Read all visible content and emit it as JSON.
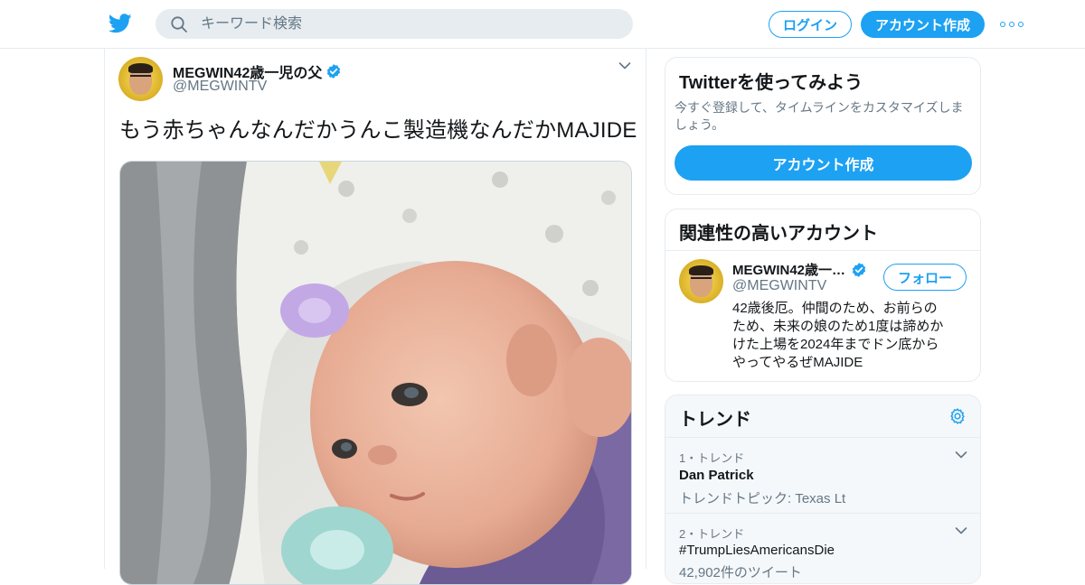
{
  "header": {
    "search_placeholder": "キーワード検索",
    "login_label": "ログイン",
    "signup_label": "アカウント作成"
  },
  "tweet": {
    "author_name": "MEGWIN42歳一児の父",
    "author_handle": "@MEGWINTV",
    "text": "もう赤ちゃんなんだかうんこ製造機なんだかMAJIDE"
  },
  "sidebar": {
    "try_twitter": {
      "title": "Twitterを使ってみよう",
      "description": "今すぐ登録して、タイムラインをカスタマイズしましょう。",
      "cta_label": "アカウント作成"
    },
    "related": {
      "title": "関連性の高いアカウント",
      "account": {
        "name": "MEGWIN42歳一…",
        "handle": "@MEGWINTV",
        "follow_label": "フォロー",
        "bio": "42歳後厄。仲間のため、お前らのため、未来の娘のため1度は諦めかけた上場を2024年までドン底からやってやるぜMAJIDE"
      }
    },
    "trends": {
      "title": "トレンド",
      "items": [
        {
          "meta": "1・トレンド",
          "name": "Dan Patrick",
          "sub": "トレンドトピック: Texas Lt"
        },
        {
          "meta": "2・トレンド",
          "name": "#TrumpLiesAmericansDie",
          "sub": "42,902件のツイート"
        }
      ]
    }
  },
  "colors": {
    "accent": "#1da1f2",
    "text": "#14171a",
    "muted": "#657786",
    "border": "#e6ecf0"
  }
}
